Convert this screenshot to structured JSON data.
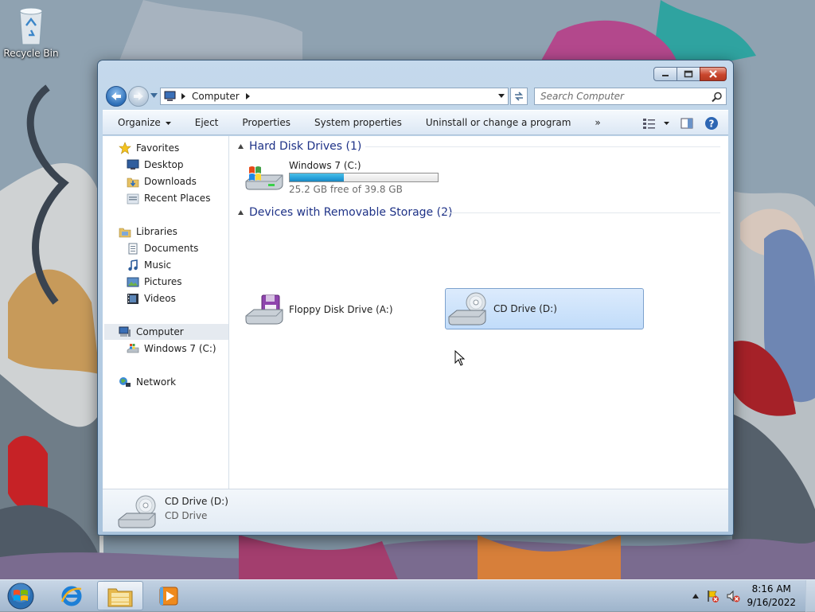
{
  "desktop": {
    "recycle_bin_label": "Recycle Bin"
  },
  "window": {
    "address": {
      "crumb": "Computer",
      "icon": "computer-icon"
    },
    "search": {
      "placeholder": "Search Computer"
    },
    "commands": [
      {
        "label": "Organize",
        "has_dropdown": true
      },
      {
        "label": "Eject"
      },
      {
        "label": "Properties"
      },
      {
        "label": "System properties"
      },
      {
        "label": "Uninstall or change a program"
      },
      {
        "label": "»"
      }
    ],
    "nav_pane": {
      "favorites": {
        "label": "Favorites",
        "icon": "star-icon"
      },
      "favorites_items": [
        {
          "label": "Desktop",
          "icon": "desktop-icon"
        },
        {
          "label": "Downloads",
          "icon": "downloads-folder-icon"
        },
        {
          "label": "Recent Places",
          "icon": "recent-places-icon"
        }
      ],
      "libraries": {
        "label": "Libraries",
        "icon": "libraries-icon"
      },
      "libraries_items": [
        {
          "label": "Documents",
          "icon": "documents-icon"
        },
        {
          "label": "Music",
          "icon": "music-icon"
        },
        {
          "label": "Pictures",
          "icon": "pictures-icon"
        },
        {
          "label": "Videos",
          "icon": "videos-icon"
        }
      ],
      "computer": {
        "label": "Computer",
        "icon": "computer-icon",
        "selected": true
      },
      "computer_items": [
        {
          "label": "Windows 7 (C:)",
          "icon": "hard-drive-icon"
        }
      ],
      "network": {
        "label": "Network",
        "icon": "network-icon"
      }
    },
    "groups": {
      "hard_disk": {
        "header": "Hard Disk Drives (1)",
        "drives": [
          {
            "name": "Windows 7 (C:)",
            "free_text": "25.2 GB free of 39.8 GB",
            "used_fraction": 0.367,
            "icon": "windows-hard-drive-icon"
          }
        ]
      },
      "removable": {
        "header": "Devices with Removable Storage (2)",
        "drives": [
          {
            "name": "Floppy Disk Drive (A:)",
            "icon": "floppy-drive-icon"
          },
          {
            "name": "CD Drive (D:)",
            "icon": "cd-drive-icon",
            "selected": true
          }
        ]
      }
    },
    "details": {
      "name": "CD Drive (D:)",
      "type": "CD Drive"
    }
  },
  "taskbar": {
    "clock_time": "8:16 AM",
    "clock_date": "9/16/2022",
    "pinned": [
      "internet-explorer-icon",
      "windows-explorer-icon",
      "media-player-icon"
    ]
  },
  "colors": {
    "accent": "#26a0da",
    "group_header": "#1e3287",
    "selection": "#c1dcfa"
  }
}
